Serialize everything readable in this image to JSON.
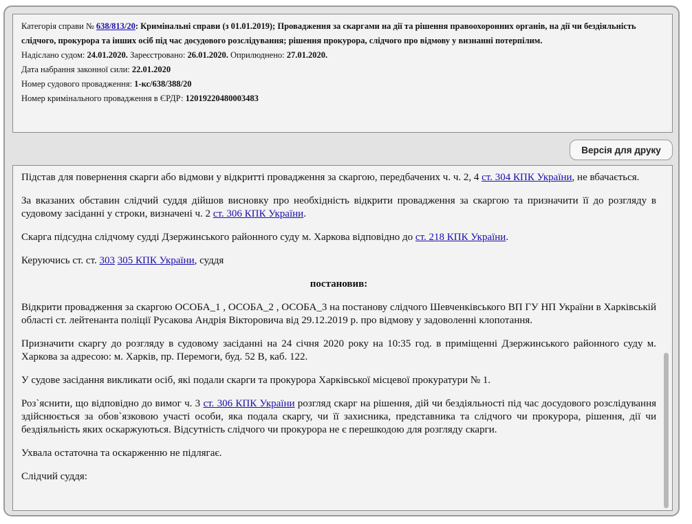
{
  "header": {
    "category_label": "Категорія справи № ",
    "case_number": "638/813/20",
    "category_text": ": Кримінальні справи (з 01.01.2019); Провадження за скаргами на дії та рішення правоохоронних органів, на дії чи бездіяльність слідчого, прокурора та інших осіб під час досудового розслідування; рішення прокурора, слідчого про відмову у визнанні потерпілим.",
    "sent_label": "Надіслано судом: ",
    "sent_date": "24.01.2020.",
    "registered_label": " Зареєстровано: ",
    "registered_date": "26.01.2020.",
    "published_label": " Оприлюднено: ",
    "published_date": "27.01.2020.",
    "effective_label": "Дата набрання законної сили: ",
    "effective_date": "22.01.2020",
    "proceeding_label": "Номер судового провадження: ",
    "proceeding_number": "1-кс/638/388/20",
    "erdr_label": "Номер кримінального провадження в ЄРДР: ",
    "erdr_number": "12019220480003483"
  },
  "print_button": "Версія для друку",
  "content": {
    "p1_a": "Підстав для повернення скарги або відмови у відкритті провадження за скаргою, передбачених ч. ч. 2, 4 ",
    "p1_link": "ст. 304 КПК України",
    "p1_b": ", не вбачається.",
    "p2_a": "За вказаних обставин слідчий суддя дійшов висновку про необхідність відкрити провадження за скаргою та призначити її до розгляду в судовому засіданні у строки, визначені ч. 2 ",
    "p2_link": "ст. 306 КПК України",
    "p2_b": ".",
    "p3_a": "Скарга підсудна слідчому судді Дзержинського районного суду м. Харкова відповідно до ",
    "p3_link": "ст. 218 КПК України",
    "p3_b": ".",
    "p4_a": "Керуючись ст. ст. ",
    "p4_link1": "303",
    "p4_link2": "305 КПК України",
    "p4_b": ", суддя",
    "resolved": "постановив:",
    "p5": "Відкрити провадження за скаргою ОСОБА_1 , ОСОБА_2 , ОСОБА_3 на постанову слідчого Шевченківського ВП ГУ НП України в Харківській області ст. лейтенанта поліції Русакова Андрія Вікторовича від 29.12.2019 р. про відмову у задоволенні клопотання.",
    "p6": "Призначити скаргу до розгляду в судовому засіданні на 24 січня 2020 року на 10:35 год. в приміщенні Дзержинського районного суду м. Харкова за адресою: м. Харків, пр. Перемоги, буд. 52 В, каб. 122.",
    "p7": "У судове засідання викликати осіб, які подали скарги та прокурора Харківської місцевої прокуратури № 1.",
    "p8_a": "Роз`яснити, що відповідно до вимог ч. 3 ",
    "p8_link": "ст. 306 КПК України",
    "p8_b": " розгляд скарг на рішення, дій чи бездіяльності під час досудового розслідування здійснюється за обов`язковою участі особи, яка подала скаргу, чи її захисника, представника та слідчого чи прокурора, рішення, дії чи бездіяльність яких оскаржуються. Відсутність слідчого чи прокурора не є перешкодою для розгляду скарги.",
    "p9": "Ухвала остаточна та оскарженню не підлягає.",
    "p10": "Слідчий суддя:"
  }
}
